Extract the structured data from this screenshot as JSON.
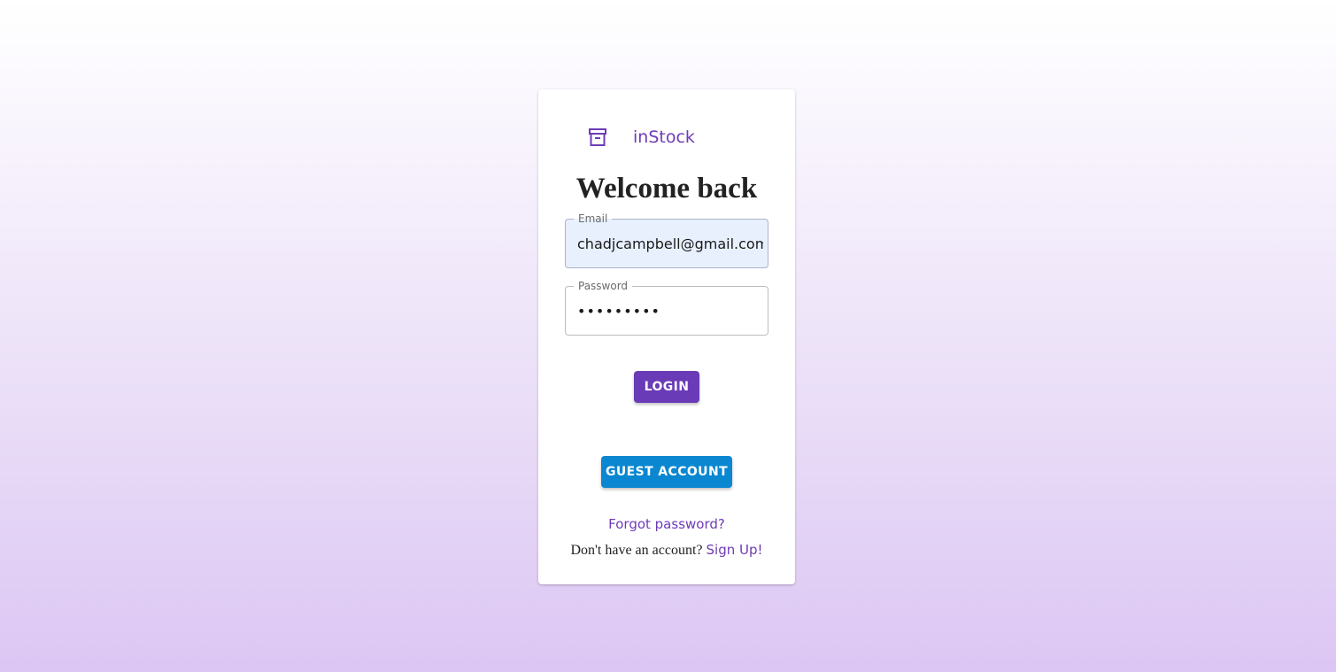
{
  "brand": {
    "name": "inStock",
    "icon": "archive-box-icon",
    "color": "#6e3bb8"
  },
  "login": {
    "title": "Welcome back",
    "email": {
      "label": "Email",
      "value": "chadjcampbell@gmail.com"
    },
    "password": {
      "label": "Password",
      "value": "•••••••••"
    },
    "login_button": "LOGIN",
    "guest_button": "GUEST ACCOUNT",
    "forgot_link": "Forgot password?",
    "signup_prompt": "Don't have an account?",
    "signup_link": "Sign Up!"
  },
  "colors": {
    "primary": "#6a3bb6",
    "guest": "#0a87d0",
    "autofill_bg": "#e8f0fe"
  }
}
